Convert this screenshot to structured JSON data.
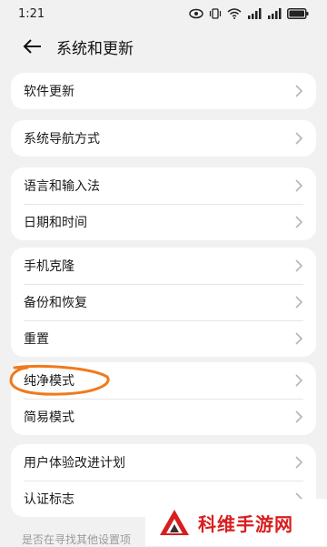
{
  "status_bar": {
    "time": "1:21"
  },
  "header": {
    "title": "系统和更新"
  },
  "groups": [
    {
      "items": [
        {
          "label": "软件更新"
        }
      ]
    },
    {
      "items": [
        {
          "label": "系统导航方式"
        }
      ]
    },
    {
      "items": [
        {
          "label": "语言和输入法"
        },
        {
          "label": "日期和时间"
        }
      ]
    },
    {
      "items": [
        {
          "label": "手机克隆"
        },
        {
          "label": "备份和恢复"
        },
        {
          "label": "重置"
        }
      ]
    },
    {
      "items": [
        {
          "label": "纯净模式"
        },
        {
          "label": "简易模式"
        }
      ]
    },
    {
      "items": [
        {
          "label": "用户体验改进计划"
        },
        {
          "label": "认证标志"
        }
      ]
    }
  ],
  "footer": {
    "hint": "是否在寻找其他设置项"
  },
  "watermark": {
    "text": "科维手游网"
  },
  "colors": {
    "background": "#f1f1f1",
    "card": "#ffffff",
    "annotation": "#f07a1c",
    "watermark_red": "#d81e1e"
  },
  "icons": [
    "back-arrow-icon",
    "chevron-right-icon",
    "eye-icon",
    "vibrate-icon",
    "wifi-icon",
    "signal-icon",
    "battery-icon",
    "logo-icon"
  ]
}
